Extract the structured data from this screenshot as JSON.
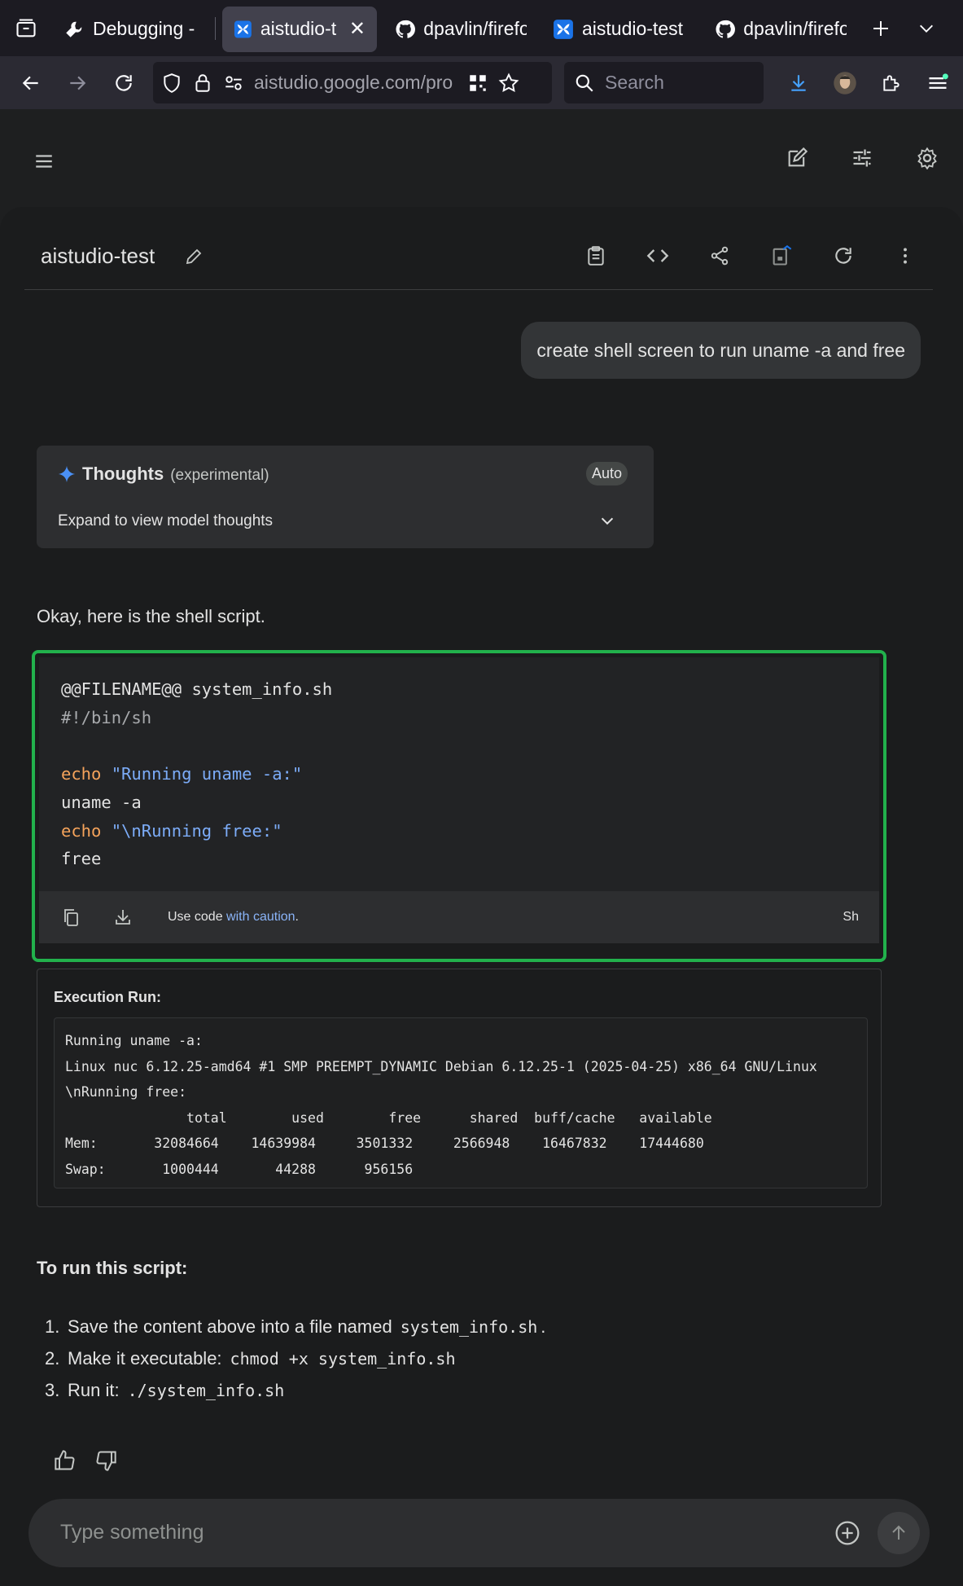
{
  "browser": {
    "tabs": [
      {
        "title": "Debugging - ",
        "icon": "wrench-icon",
        "active": false
      },
      {
        "title": "aistudio-te",
        "icon": "aistudio-icon",
        "active": true
      },
      {
        "title": "dpavlin/firefo",
        "icon": "github-icon",
        "active": false
      },
      {
        "title": "aistudio-test",
        "icon": "aistudio-icon",
        "active": false
      },
      {
        "title": "dpavlin/firefo",
        "icon": "github-icon",
        "active": false
      }
    ],
    "url": "aistudio.google.com/pro",
    "search_placeholder": "Search"
  },
  "prompt": {
    "title": "aistudio-test"
  },
  "user_message": "create shell screen to run uname -a and free",
  "thoughts": {
    "title": "Thoughts",
    "subtitle": "(experimental)",
    "mode": "Auto",
    "expand_label": "Expand to view model thoughts"
  },
  "response": {
    "intro": "Okay, here is the shell script.",
    "code": {
      "lines": [
        "@@FILENAME@@ system_info.sh",
        "#!/bin/sh",
        "",
        "echo \"Running uname -a:\"",
        "uname -a",
        "echo \"\\nRunning free:\"",
        "free"
      ],
      "caution_prefix": "Use code ",
      "caution_link": "with caution",
      "caution_suffix": ".",
      "language": "Sh"
    },
    "execution": {
      "label": "Execution Run:",
      "output": [
        "Running uname -a:",
        "Linux nuc 6.12.25-amd64 #1 SMP PREEMPT_DYNAMIC Debian 6.12.25-1 (2025-04-25) x86_64 GNU/Linux",
        "\\nRunning free:",
        "               total        used        free      shared  buff/cache   available",
        "Mem:       32084664    14639984     3501332     2566948    16467832    17444680",
        "Swap:       1000444       44288      956156"
      ]
    },
    "run_heading": "To run this script:",
    "steps": [
      {
        "num": "1.",
        "text": "Save the content above into a file named",
        "code": "system_info.sh",
        "suffix": "."
      },
      {
        "num": "2.",
        "text": "Make it executable:",
        "code": "chmod +x system_info.sh",
        "suffix": ""
      },
      {
        "num": "3.",
        "text": "Run it:",
        "code": "./system_info.sh",
        "suffix": ""
      }
    ]
  },
  "composer": {
    "placeholder": "Type something"
  },
  "colors": {
    "accent_green": "#22b14c",
    "link_blue": "#8ab4f8",
    "keyword": "#f5a35b",
    "string": "#7cacf8"
  }
}
